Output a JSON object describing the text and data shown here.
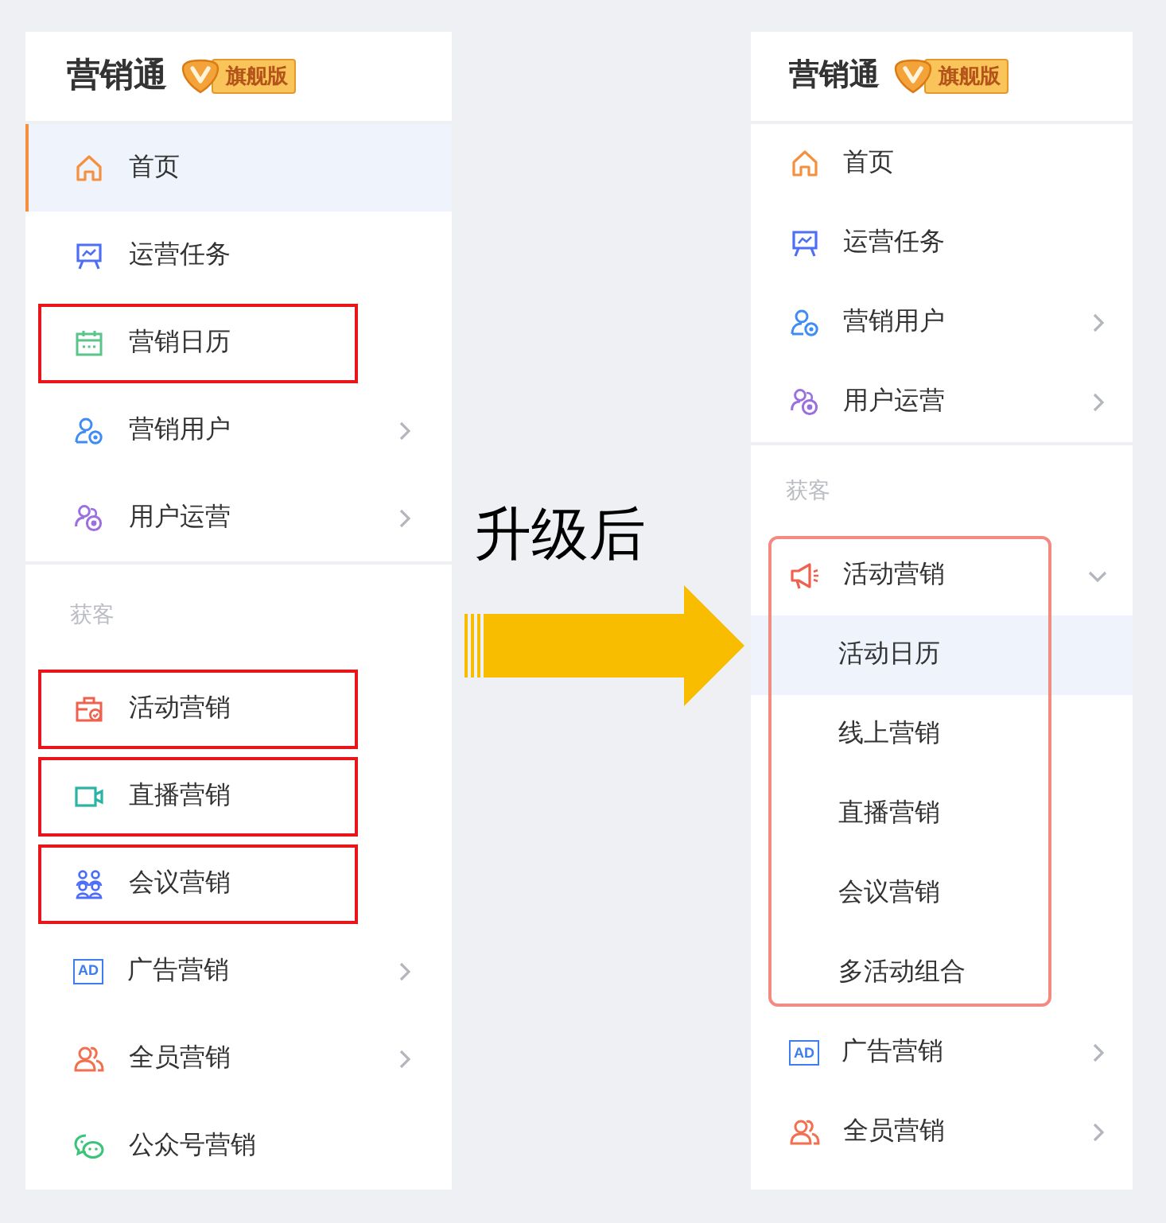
{
  "panels": [
    {
      "brand": "营销通",
      "badge": "旗舰版",
      "sections": [
        {
          "items": [
            {
              "label": "首页",
              "selected": true,
              "highlighted": false
            },
            {
              "label": "运营任务",
              "selected": false,
              "highlighted": false
            },
            {
              "label": "营销日历",
              "selected": false,
              "highlighted": true
            },
            {
              "label": "营销用户",
              "selected": false,
              "highlighted": false,
              "expanded": false
            },
            {
              "label": "用户运营",
              "selected": false,
              "highlighted": false,
              "expanded": false
            }
          ]
        },
        {
          "title": "获客",
          "items": [
            {
              "label": "活动营销",
              "selected": false,
              "highlighted": true
            },
            {
              "label": "直播营销",
              "selected": false,
              "highlighted": true
            },
            {
              "label": "会议营销",
              "selected": false,
              "highlighted": true
            },
            {
              "label": "广告营销",
              "icon_text": "AD",
              "selected": false,
              "highlighted": false,
              "expanded": false
            },
            {
              "label": "全员营销",
              "selected": false,
              "highlighted": false,
              "expanded": false
            },
            {
              "label": "公众号营销",
              "selected": false,
              "highlighted": false
            }
          ]
        }
      ]
    },
    {
      "brand": "营销通",
      "badge": "旗舰版",
      "sections": [
        {
          "items": [
            {
              "label": "首页",
              "selected": false,
              "highlighted": false
            },
            {
              "label": "运营任务",
              "selected": false,
              "highlighted": false
            },
            {
              "label": "营销用户",
              "selected": false,
              "highlighted": false,
              "expanded": false
            },
            {
              "label": "用户运营",
              "selected": false,
              "highlighted": false,
              "expanded": false
            }
          ]
        },
        {
          "title": "获客",
          "items": [
            {
              "label": "活动营销",
              "selected": false,
              "highlighted": true,
              "expanded": true,
              "children": [
                {
                  "label": "活动日历",
                  "selected": true
                },
                {
                  "label": "线上营销",
                  "selected": false
                },
                {
                  "label": "直播营销",
                  "selected": false
                },
                {
                  "label": "会议营销",
                  "selected": false
                },
                {
                  "label": "多活动组合",
                  "selected": false
                }
              ]
            },
            {
              "label": "广告营销",
              "icon_text": "AD",
              "selected": false,
              "highlighted": false,
              "expanded": false
            },
            {
              "label": "全员营销",
              "selected": false,
              "highlighted": false,
              "expanded": false
            }
          ]
        }
      ]
    }
  ],
  "transition_label": "升级后"
}
